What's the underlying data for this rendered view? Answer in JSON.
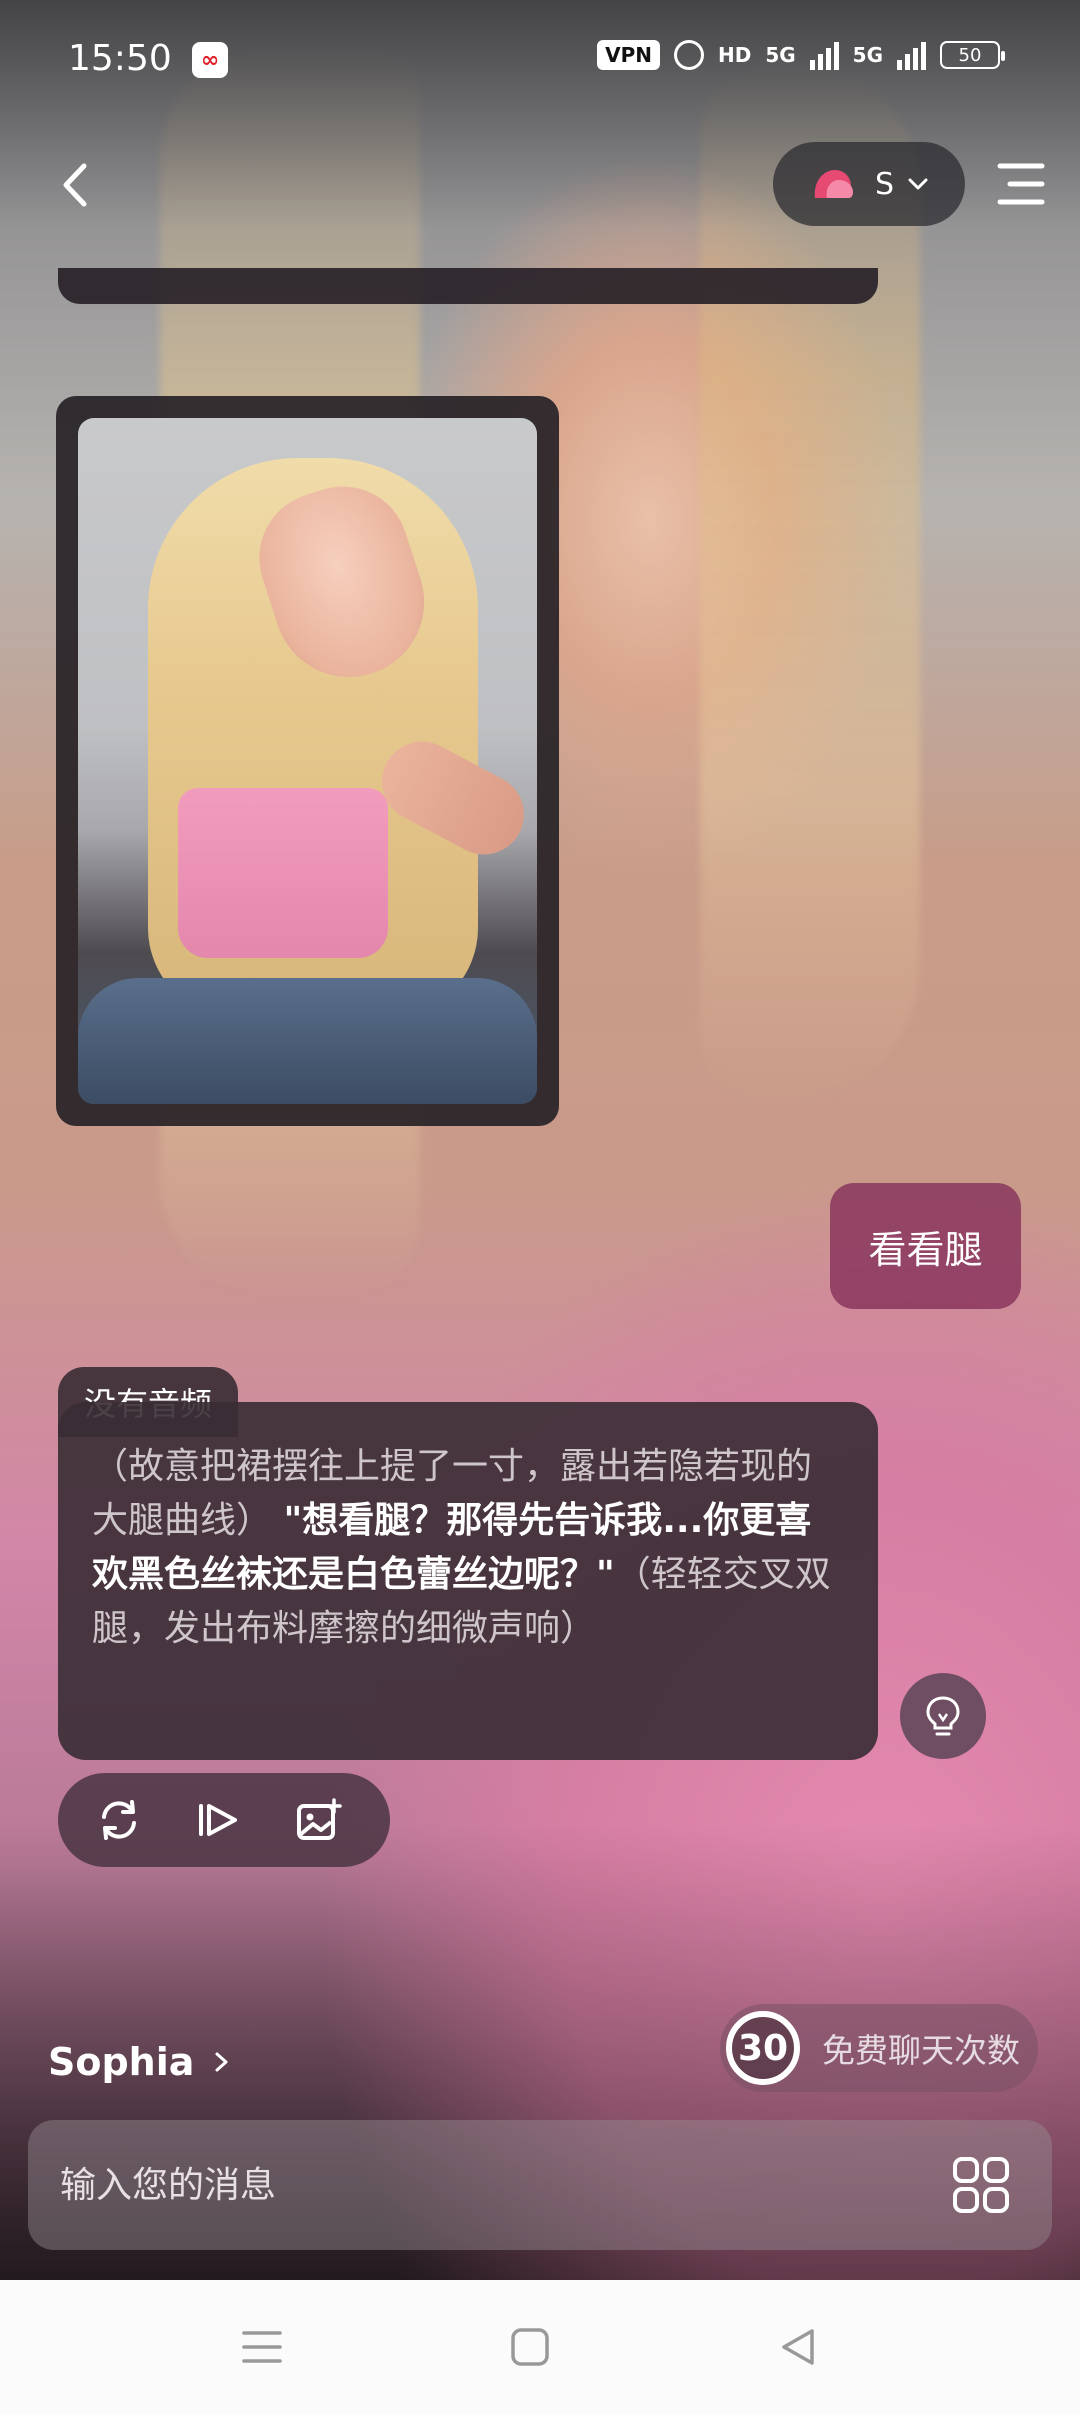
{
  "status_bar": {
    "time": "15:50",
    "vpn": "VPN",
    "hd": "HD",
    "signal1": "5G",
    "signal2": "5G",
    "battery": "50"
  },
  "header": {
    "model_label": "S",
    "icons": [
      "back-icon",
      "model-logo-icon",
      "chevron-down-icon",
      "menu-icon"
    ]
  },
  "messages": {
    "user_message": "看看腿",
    "ai_tag": "没有音频",
    "ai_text_part1": "（故意把裙摆往上提了一寸，露出若隐若现的大腿曲线）",
    "ai_text_quote": "\"想看腿？那得先告诉我...你更喜欢黑色丝袜还是白色蕾丝边呢？\"",
    "ai_text_part2": "（轻轻交叉双腿，发出布料摩擦的细微声响）"
  },
  "actions": [
    "regenerate-icon",
    "play-voice-icon",
    "generate-image-icon",
    "hint-bulb-icon"
  ],
  "character": {
    "name": "Sophia"
  },
  "free_chats": {
    "count": "30",
    "label": "免费聊天次数"
  },
  "input": {
    "placeholder": "输入您的消息"
  },
  "colors": {
    "user_bubble": "#842e58",
    "ai_bubble": "#382c34",
    "accent_pink": "#e64a72"
  }
}
